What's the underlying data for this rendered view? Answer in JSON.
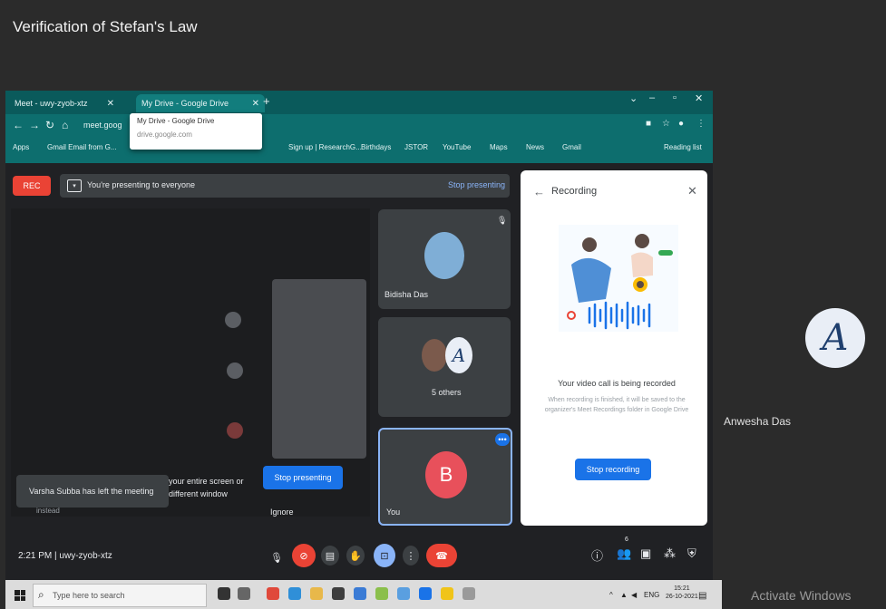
{
  "slide": {
    "title": "Verification of Stefan's Law",
    "participant_name": "Anwesha Das",
    "watermark": "Activate Windows"
  },
  "browser": {
    "tabs": [
      {
        "label": "Meet - uwy-zyob-xtz"
      },
      {
        "label": "My Drive - Google Drive"
      }
    ],
    "new_tab": "+",
    "url": "meet.goog",
    "tooltip": {
      "title": "My Drive - Google Drive",
      "subtitle": "drive.google.com"
    },
    "bookmarks": [
      {
        "label": "Apps"
      },
      {
        "label": "Gmail  Email from G..."
      },
      {
        "label": "Sign up | ResearchG..."
      },
      {
        "label": "Birthdays"
      },
      {
        "label": "JSTOR"
      },
      {
        "label": "YouTube"
      },
      {
        "label": "Maps"
      },
      {
        "label": "News"
      },
      {
        "label": "Gmail"
      },
      {
        "label": "Reading list"
      }
    ]
  },
  "meet": {
    "rec_label": "REC",
    "presenting_text": "You're presenting to everyone",
    "stop_presenting_link": "Stop presenting",
    "share_warning": "your entire screen or different window",
    "stop_presenting_button": "Stop presenting",
    "ignore": "Ignore",
    "toast": "Varsha Subba has left the meeting",
    "toast_sub": "instead",
    "tiles": [
      {
        "name": "Bidisha Das"
      },
      {
        "name": "5 others"
      },
      {
        "name": "You",
        "initial": "B"
      }
    ],
    "more_icon": "•••",
    "meeting_time": "2:21 PM",
    "meeting_code": "uwy-zyob-xtz",
    "participant_count": "6"
  },
  "recording_panel": {
    "title": "Recording",
    "status": "Your video call is being recorded",
    "description": "When recording is finished, it will be saved to the organizer's Meet Recordings folder in Google Drive",
    "stop_button": "Stop recording"
  },
  "taskbar": {
    "search_placeholder": "Type here to search",
    "time": "15:21",
    "date": "26-10-2021",
    "lang": "ENG"
  },
  "colors": {
    "meet_bg": "#202124",
    "browser_teal": "#0d6e6e",
    "accent_blue": "#1a73e8",
    "rec_red": "#ea4335"
  }
}
